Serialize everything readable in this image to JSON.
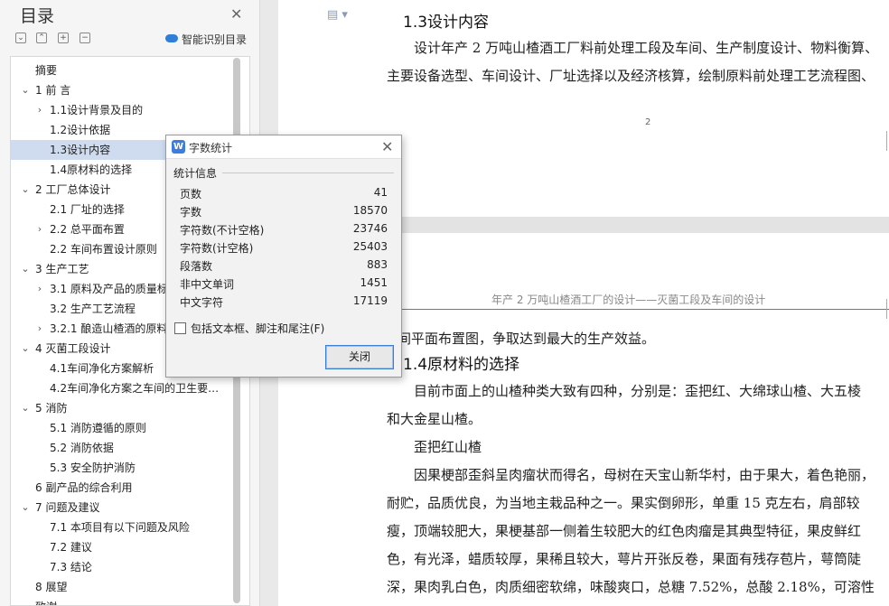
{
  "toc": {
    "title": "目录",
    "smart_label": "智能识别目录",
    "items": [
      {
        "label": "摘要",
        "chev": ""
      },
      {
        "label": "1 前  言",
        "chev": "⌄"
      },
      {
        "label": "1.1设计背景及目的",
        "chev": "›"
      },
      {
        "label": "1.2设计依据",
        "chev": ""
      },
      {
        "label": "1.3设计内容",
        "chev": ""
      },
      {
        "label": "1.4原材料的选择",
        "chev": ""
      },
      {
        "label": "2  工厂总体设计",
        "chev": "⌄"
      },
      {
        "label": "2.1  厂址的选择",
        "chev": ""
      },
      {
        "label": "2.2  总平面布置",
        "chev": "›"
      },
      {
        "label": "2.2  车间布置设计原则",
        "chev": ""
      },
      {
        "label": "3  生产工艺",
        "chev": "⌄"
      },
      {
        "label": "3.1  原料及产品的质量标",
        "chev": "›"
      },
      {
        "label": "3.2  生产工艺流程",
        "chev": ""
      },
      {
        "label": "3.2.1  酿造山楂酒的原料",
        "chev": "›"
      },
      {
        "label": "4  灭菌工段设计",
        "chev": "⌄"
      },
      {
        "label": "4.1车间净化方案解析",
        "chev": ""
      },
      {
        "label": "4.2车间净化方案之车间的卫生要…",
        "chev": ""
      },
      {
        "label": "5  消防",
        "chev": "⌄"
      },
      {
        "label": "5.1  消防遵循的原则",
        "chev": ""
      },
      {
        "label": "5.2  消防依据",
        "chev": ""
      },
      {
        "label": "5.3  安全防护消防",
        "chev": ""
      },
      {
        "label": "6  副产品的综合利用",
        "chev": ""
      },
      {
        "label": "7  问题及建议",
        "chev": "⌄"
      },
      {
        "label": "7.1  本项目有以下问题及风险",
        "chev": ""
      },
      {
        "label": "7.2  建议",
        "chev": ""
      },
      {
        "label": "7.3  结论",
        "chev": ""
      },
      {
        "label": "8  展望",
        "chev": ""
      },
      {
        "label": "致谢",
        "chev": ""
      }
    ]
  },
  "document": {
    "page1": {
      "heading": "1.3设计内容",
      "line1": "设计年产 2 万吨山楂酒工厂料前处理工段及车间、生产制度设计、物料衡算、",
      "line2": "主要设备选型、车间设计、厂址选择以及经济核算，绘制原料前处理工艺流程图、",
      "page_number": "2"
    },
    "page2": {
      "header": "年产 2 万吨山楂酒工厂的设计——灭菌工段及车间的设计",
      "cont": "间平面布置图，争取达到最大的生产效益。",
      "heading": "1.4原材料的选择",
      "lines": [
        "目前市面上的山楂种类大致有四种，分别是：歪把红、大绵球山楂、大五棱",
        "和大金星山楂。",
        "歪把红山楂",
        "因果梗部歪斜呈肉瘤状而得名，母树在天宝山新华村，由于果大，着色艳丽，",
        "耐贮，品质优良，为当地主栽品种之一。果实倒卵形，单重 15 克左右，肩部较",
        "瘦，顶端较肥大，果梗基部一侧着生较肥大的红色肉瘤是其典型特征，果皮鲜红",
        "色，有光泽，蜡质较厚，果稀且较大，萼片开张反卷，果面有残存苞片，萼筒陡",
        "深，果肉乳白色，肉质细密软绵，味酸爽口，总糖 7.52%，总酸 2.18%，可溶性"
      ]
    }
  },
  "dialog": {
    "title": "字数统计",
    "group_label": "统计信息",
    "stats": [
      {
        "label": "页数",
        "value": "41"
      },
      {
        "label": "字数",
        "value": "18570"
      },
      {
        "label": "字符数(不计空格)",
        "value": "23746"
      },
      {
        "label": "字符数(计空格)",
        "value": "25403"
      },
      {
        "label": "段落数",
        "value": "883"
      },
      {
        "label": "非中文单词",
        "value": "1451"
      },
      {
        "label": "中文字符",
        "value": "17119"
      }
    ],
    "checkbox_label": "包括文本框、脚注和尾注(F)",
    "checkbox_checked": false,
    "close_button": "关闭"
  }
}
